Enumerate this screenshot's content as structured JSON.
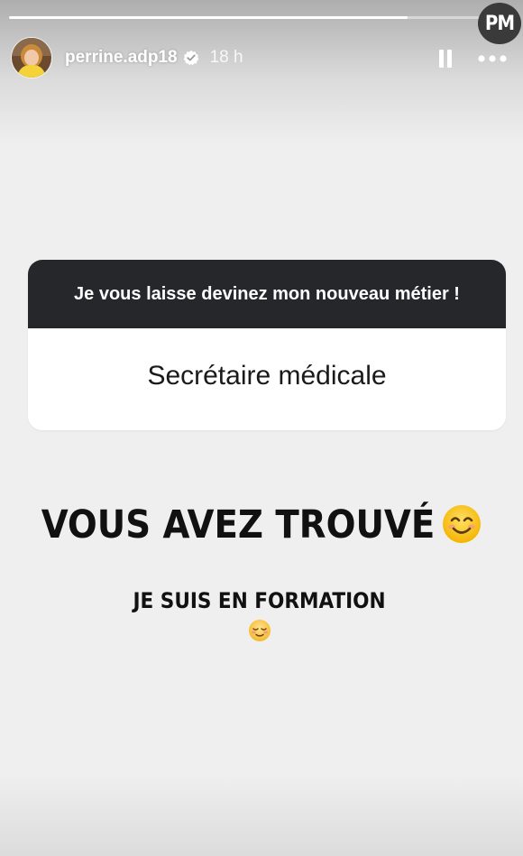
{
  "watermark": {
    "text": "PM"
  },
  "header": {
    "username": "perrine.adp18",
    "time": "18 h",
    "avatar_icon": "profile-photo",
    "verified_icon": "verified-badge-icon",
    "pause_icon": "pause-icon",
    "more_icon": "more-dots-icon"
  },
  "progress": {
    "fraction": 0.79
  },
  "question_sticker": {
    "question": "Je vous laisse devinez mon nouveau métier !",
    "answer": "Secrétaire médicale"
  },
  "caption": {
    "headline": "VOUS AVEZ TROUVÉ",
    "headline_emoji": "smiling-face-icon",
    "subline": "JE SUIS EN FORMATION",
    "subline_emoji": "relieved-face-icon"
  },
  "colors": {
    "background": "#efefef",
    "sticker_header": "#26272b",
    "text": "#111111"
  }
}
